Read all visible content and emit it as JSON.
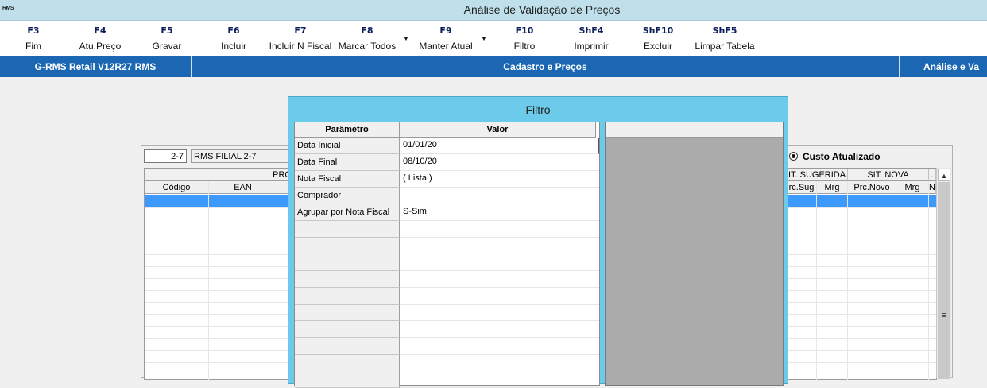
{
  "window": {
    "title": "Análise de Validação de Preços",
    "logo_text": "RMS"
  },
  "toolbar": [
    {
      "key": "F3",
      "label": "Fim"
    },
    {
      "key": "F4",
      "label": "Atu.Preço"
    },
    {
      "key": "F5",
      "label": "Gravar"
    },
    {
      "key": "F6",
      "label": "Incluir"
    },
    {
      "key": "F7",
      "label": "Incluir N Fiscal"
    },
    {
      "key": "F8",
      "label": "Marcar Todos"
    },
    {
      "key": "F9",
      "label": "Manter Atual"
    },
    {
      "key": "F10",
      "label": "Filtro"
    },
    {
      "key": "ShF4",
      "label": "Imprimir"
    },
    {
      "key": "ShF10",
      "label": "Excluir"
    },
    {
      "key": "ShF5",
      "label": "Limpar Tabela"
    }
  ],
  "header": {
    "system": "G-RMS Retail V12R27 RMS",
    "module": "Cadastro e Preços",
    "program": "Análise e Va"
  },
  "branch": {
    "code": "2-7",
    "name": "RMS FILIAL 2-7"
  },
  "grid_left": {
    "group": "PRO",
    "columns": [
      "Código",
      "EAN"
    ]
  },
  "cost_option": {
    "label": "Custo Atualizado",
    "selected": true
  },
  "grid_right": {
    "groups": [
      "IT. SUGERIDA",
      "SIT. NOVA",
      "."
    ],
    "columns": [
      "rc.Sug",
      "Mrg",
      "Prc.Novo",
      "Mrg",
      "N"
    ]
  },
  "filter_dialog": {
    "title": "Filtro",
    "columns": [
      "Parâmetro",
      "Valor"
    ],
    "rows": [
      {
        "param": "Data Inicial",
        "value": "01/01/20"
      },
      {
        "param": "Data Final",
        "value": "08/10/20"
      },
      {
        "param": "Nota Fiscal",
        "value": "( Lista )"
      },
      {
        "param": "Comprador",
        "value": ""
      },
      {
        "param": "Agrupar por Nota Fiscal",
        "value": "S-Sim"
      }
    ]
  },
  "colors": {
    "title_bar": "#bfe0ea",
    "header_blue": "#1b67b3",
    "dialog": "#6ccbea",
    "selection": "#3c9aff"
  }
}
